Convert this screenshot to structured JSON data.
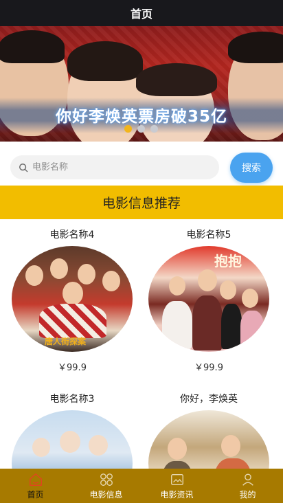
{
  "header": {
    "title": "首页"
  },
  "banner": {
    "caption": "你好李焕英票房破35亿",
    "slide_count": 3,
    "active_index": 0
  },
  "search": {
    "placeholder": "电影名称",
    "value": "",
    "button_label": "搜索"
  },
  "section": {
    "title": "电影信息推荐"
  },
  "movies": [
    {
      "name": "电影名称4",
      "price": "￥99.9",
      "logo_text": "唐人街探案"
    },
    {
      "name": "电影名称5",
      "price": "￥99.9",
      "logo_text": "抱抱"
    },
    {
      "name": "电影名称3",
      "price": "",
      "logo_text": ""
    },
    {
      "name": "你好，李焕英",
      "price": "",
      "logo_text": ""
    }
  ],
  "tabbar": {
    "active": "home",
    "items": [
      {
        "key": "home",
        "label": "首页",
        "icon": "home-icon"
      },
      {
        "key": "movie-info",
        "label": "电影信息",
        "icon": "grid-icon"
      },
      {
        "key": "movie-news",
        "label": "电影资讯",
        "icon": "image-icon"
      },
      {
        "key": "mine",
        "label": "我的",
        "icon": "person-icon"
      }
    ]
  },
  "colors": {
    "header_bg": "#18181c",
    "accent_yellow": "#f2bd00",
    "tabbar_bg": "#a77a00",
    "search_button": "#4aa3ef",
    "active_dot": "#f2b51c"
  }
}
